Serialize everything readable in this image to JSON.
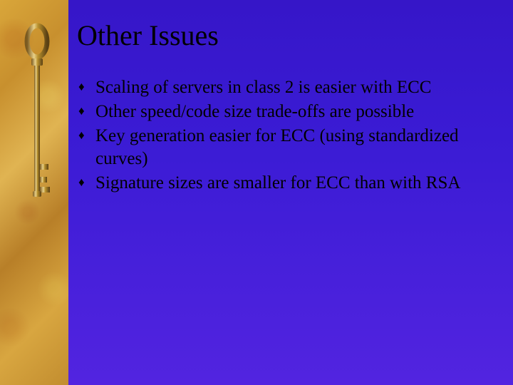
{
  "slide": {
    "title": "Other Issues",
    "bullets": [
      "Scaling of servers in class 2 is easier with ECC",
      "Other speed/code size trade-offs are possible",
      "Key generation easier for ECC (using standardized curves)",
      "Signature sizes are smaller for ECC than with RSA"
    ]
  },
  "decor": {
    "sidebar_icon": "key-icon"
  }
}
